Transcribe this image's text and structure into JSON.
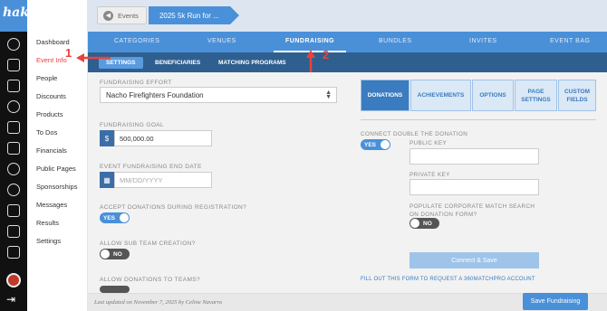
{
  "app": {
    "logo": "haku"
  },
  "subnav": [
    "Dashboard",
    "Event Info",
    "People",
    "Discounts",
    "Products",
    "To Dos",
    "Financials",
    "Public Pages",
    "Sponsorships",
    "Messages",
    "Results",
    "Settings"
  ],
  "breadcrumb": {
    "back_label": "Events",
    "current": "2025 5k Run for ..."
  },
  "tabs": [
    "CATEGORIES",
    "VENUES",
    "FUNDRAISING",
    "BUNDLES",
    "INVITES",
    "EVENT BAG"
  ],
  "subtabs": [
    "SETTINGS",
    "BENEFICIARIES",
    "MATCHING PROGRAMS"
  ],
  "annotations": {
    "one": "1",
    "two": "2"
  },
  "form": {
    "effort_label": "FUNDRAISING EFFORT",
    "effort_value": "Nacho Firefighters Foundation",
    "goal_label": "FUNDRAISING GOAL",
    "currency": "$",
    "goal_value": "500,000.00",
    "end_label": "EVENT FUNDRAISING END DATE",
    "end_placeholder": "MM/DD/YYYY",
    "accept_label": "ACCEPT DONATIONS DURING REGISTRATION?",
    "accept_value": "YES",
    "subteam_label": "ALLOW SUB TEAM CREATION?",
    "subteam_value": "NO",
    "teams_label": "ALLOW DONATIONS TO TEAMS?"
  },
  "right": {
    "tabs": [
      "DONATIONS",
      "ACHIEVEMENTS",
      "OPTIONS",
      "PAGE SETTINGS",
      "CUSTOM FIELDS"
    ],
    "connect_label": "CONNECT DOUBLE THE DONATION",
    "connect_value": "YES",
    "public_key_label": "PUBLIC KEY",
    "private_key_label": "PRIVATE KEY",
    "populate_label": "POPULATE CORPORATE MATCH SEARCH ON DONATION FORM?",
    "populate_value": "NO",
    "connect_button": "Connect & Save",
    "link": "FILL OUT THIS FORM TO REQUEST A 360MATCHPRO ACCOUNT"
  },
  "footer": {
    "updated": "Last updated on November 7, 2025 by Celine Navarro",
    "save_button": "Save Fundraising"
  }
}
